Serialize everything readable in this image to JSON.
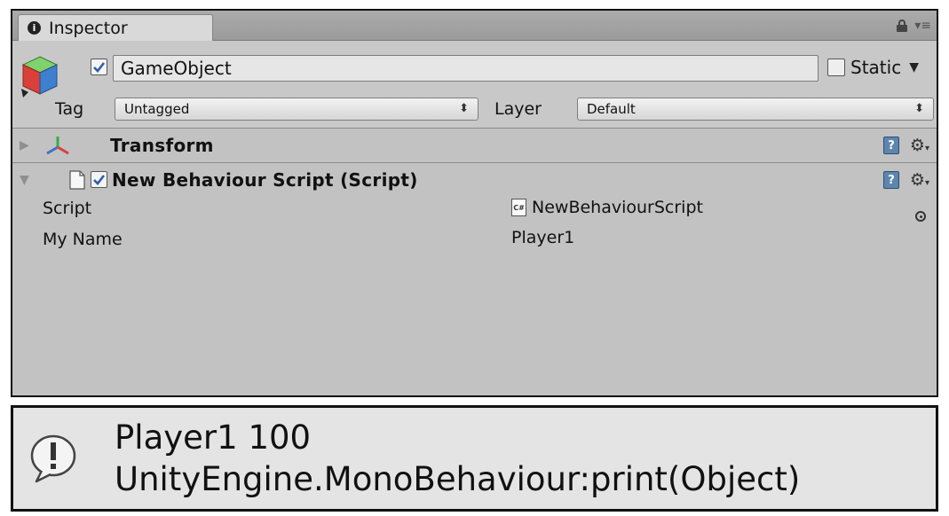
{
  "inspector": {
    "tab_label": "Inspector",
    "game_object": {
      "active": true,
      "name": "GameObject",
      "static_label": "Static",
      "static_checked": false,
      "tag_label": "Tag",
      "tag_value": "Untagged",
      "layer_label": "Layer",
      "layer_value": "Default"
    },
    "components": [
      {
        "title": "Transform",
        "expanded": false
      },
      {
        "title": "New Behaviour Script (Script)",
        "expanded": true,
        "enabled": true
      }
    ],
    "properties": [
      {
        "label": "Script",
        "value": "NewBehaviourScript"
      },
      {
        "label": "My Name",
        "value": "Player1"
      }
    ],
    "icons": [
      "info-icon",
      "lock-icon",
      "menu-icon",
      "gameobject-cube-icon",
      "transform-icon",
      "script-file-icon",
      "help-icon",
      "gear-icon",
      "csharp-file-icon",
      "object-picker-icon"
    ]
  },
  "console": {
    "line1": "Player1 100",
    "line2": "UnityEngine.MonoBehaviour:print(Object)",
    "icon": "info-bubble-icon"
  },
  "colors": {
    "panel_bg": "#c2c2c2",
    "console_bg": "#e4e4e4",
    "help_blue": "#5d86ad",
    "checkbox_check": "#2b5fa8"
  }
}
